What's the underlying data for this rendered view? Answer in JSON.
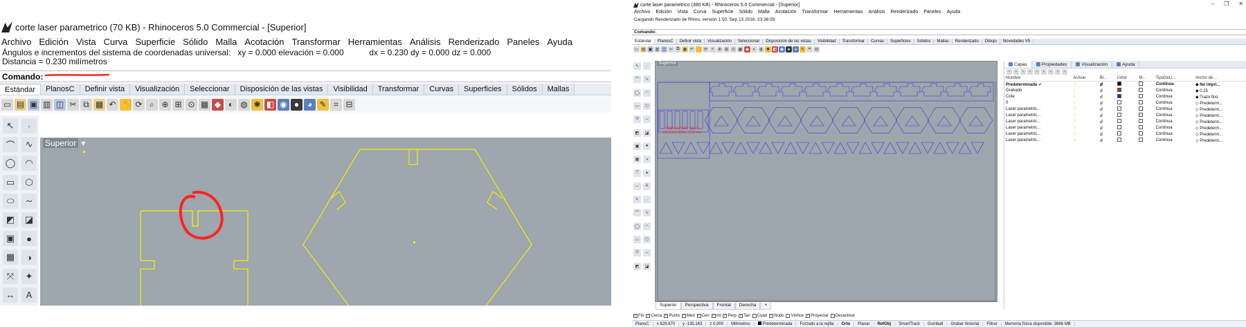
{
  "colors": {
    "viewport_bg": "#9ea6ae",
    "geometry_left": "#f5f000",
    "geometry_right": "#3b3bd6",
    "annotation_red": "#ff2222",
    "label_text_red": "#e03030"
  },
  "left": {
    "title": "corte laser parametrico (70 KB) - Rhinoceros 5.0 Commercial - [Superior]",
    "menu": [
      "Archivo",
      "Edición",
      "Vista",
      "Curva",
      "Superficie",
      "Sólido",
      "Malla",
      "Acotación",
      "Transformar",
      "Herramientas",
      "Análisis",
      "Renderizado",
      "Paneles",
      "Ayuda"
    ],
    "history": [
      "Ángulos e incrementos del sistema de coordenadas universal:   xy = 0.000 elevación = 0.000           dx = 0.230 dy = 0.000 dz = 0.000",
      "Distancia = 0.230 milímetros"
    ],
    "command_label": "Comando:",
    "tabs": [
      "Estándar",
      "PlanosC",
      "Definir vista",
      "Visualización",
      "Seleccionar",
      "Disposición de las vistas",
      "Visibilidad",
      "Transformar",
      "Curvas",
      "Superficies",
      "Sólidos",
      "Mallas"
    ],
    "active_tab": 0,
    "viewport_label": "Superior",
    "dropdown_glyph": "▾",
    "toolbar_icons": [
      "new-icon",
      "open-icon",
      "save-icon",
      "print-icon",
      "import-icon",
      "cut-icon",
      "copy-icon",
      "paste-icon",
      "undo-icon",
      "pan-icon",
      "rotate-view-icon",
      "zoom-icon",
      "zoom-window-icon",
      "zoom-extents-icon",
      "zoom-selected-icon",
      "viewport-grid-icon",
      "car-icon",
      "unhide-icon",
      "lock-icon",
      "light-icon",
      "layer-icon",
      "material-icon",
      "render-icon",
      "sphere-icon",
      "properties-icon",
      "snap-icon",
      "grid-icon"
    ],
    "side_icons": [
      "select-icon",
      "point-icon",
      "polyline-icon",
      "curve-icon",
      "circle-icon",
      "arc-icon",
      "rectangle-icon",
      "polygon-icon",
      "ellipse-icon",
      "free-curve-icon",
      "surface-icon",
      "edit-surface-icon",
      "box-icon",
      "sphere-tool-icon",
      "mesh-icon",
      "boolean-icon",
      "transform-icon",
      "explode-icon",
      "dimension-icon",
      "text-icon"
    ]
  },
  "right": {
    "title": "corte laser parametrico (380 KB) - Rhinoceros 5.0 Commercial - [Superior]",
    "window_buttons": [
      "–",
      "❐",
      "✕"
    ],
    "menu": [
      "Archivo",
      "Edición",
      "Vista",
      "Curva",
      "Superficie",
      "Sólido",
      "Malla",
      "Acotación",
      "Transformar",
      "Herramientas",
      "Análisis",
      "Renderizado",
      "Paneles",
      "Ayuda"
    ],
    "status_line": "Cargando Renderizado de Rhino, versión 1.50, Sep 13 2016, 23:38:59",
    "command_label": "Comando:",
    "tabs": [
      "Estándar",
      "PlanosC",
      "Definir vista",
      "Visualización",
      "Seleccionar",
      "Disposición de las vistas",
      "Visibilidad",
      "Transformar",
      "Curvas",
      "Superficies",
      "Sólidos",
      "Mallas",
      "Renderizado",
      "Dibujo",
      "Novedades V5"
    ],
    "viewport_label": "Superior",
    "viewport_annotation": [
      "FABACADEMY 2020",
      "MEDIDA REAL: 2.52 mm"
    ],
    "viewport_tabs": [
      "Superior",
      "Perspectiva",
      "Frontal",
      "Derecha",
      "+"
    ],
    "osnaps": [
      {
        "label": "Fin",
        "checked": true
      },
      {
        "label": "Cerca",
        "checked": true
      },
      {
        "label": "Punto",
        "checked": true
      },
      {
        "label": "Med",
        "checked": true
      },
      {
        "label": "Cen",
        "checked": true
      },
      {
        "label": "Int",
        "checked": true
      },
      {
        "label": "Perp",
        "checked": true
      },
      {
        "label": "Tan",
        "checked": true
      },
      {
        "label": "Cuad",
        "checked": false
      },
      {
        "label": "Nodo",
        "checked": true
      },
      {
        "label": "Vértice",
        "checked": false
      },
      {
        "label": "Proyectar",
        "checked": true
      },
      {
        "label": "Desactivar",
        "checked": false
      }
    ],
    "statusbar": {
      "cplane": "PlanoC",
      "x": "x 829.670",
      "y": "y -135.163",
      "z": "z 0.000",
      "units": "Milímetros",
      "layer": "Predeterminada",
      "grid_snap": "Forzado a la rejilla",
      "ortho": "Orto",
      "planar": "Planar",
      "osnap": "RefObj",
      "smarttrack": "SmartTrack",
      "gumball": "Gumball",
      "history": "Grabar historial",
      "filter": "Filtrar",
      "memory": "Memoria física disponible: 3866 MB"
    },
    "panel_tabs": [
      "Capas",
      "Propiedades",
      "Visualización",
      "Ayuda"
    ],
    "layer_columns": [
      "Nombre",
      "Activar",
      "Bl...",
      "Color",
      "M...",
      "TipoDeLí...",
      "Ancho de ..."
    ],
    "layers": [
      {
        "name": "Predeterminada",
        "check": "✓",
        "color": "#000000",
        "linetype": "Continua",
        "width": "No impri...",
        "current": true
      },
      {
        "name": "Grabado",
        "check": "",
        "color": "#e02020",
        "linetype": "Continua",
        "width": "0.25",
        "current": false
      },
      {
        "name": "Cote",
        "check": "",
        "color": "#2030d0",
        "linetype": "Continua",
        "width": "Trazo fino",
        "current": false
      },
      {
        "name": "0",
        "check": "",
        "color": "#ffffff",
        "linetype": "Continua",
        "width": "Predeterm...",
        "current": false
      },
      {
        "name": "Laser parametric...",
        "check": "",
        "color": "#ffffff",
        "linetype": "Continua",
        "width": "Predeterm...",
        "current": false
      },
      {
        "name": "Laser parametric...",
        "check": "",
        "color": "#ffffff",
        "linetype": "Continua",
        "width": "Predeterm...",
        "current": false
      },
      {
        "name": "Laser parametric...",
        "check": "",
        "color": "#ffffff",
        "linetype": "Continua",
        "width": "Predeterm...",
        "current": false
      },
      {
        "name": "Laser parametric...",
        "check": "",
        "color": "#ffffff",
        "linetype": "Continua",
        "width": "Predeterm...",
        "current": false
      },
      {
        "name": "Laser parametric...",
        "check": "",
        "color": "#ffffff",
        "linetype": "Continua",
        "width": "Predeterm...",
        "current": false
      },
      {
        "name": "Laser parametric...",
        "check": "",
        "color": "#ffffff",
        "linetype": "Continua",
        "width": "Predeterm...",
        "current": false
      }
    ]
  }
}
